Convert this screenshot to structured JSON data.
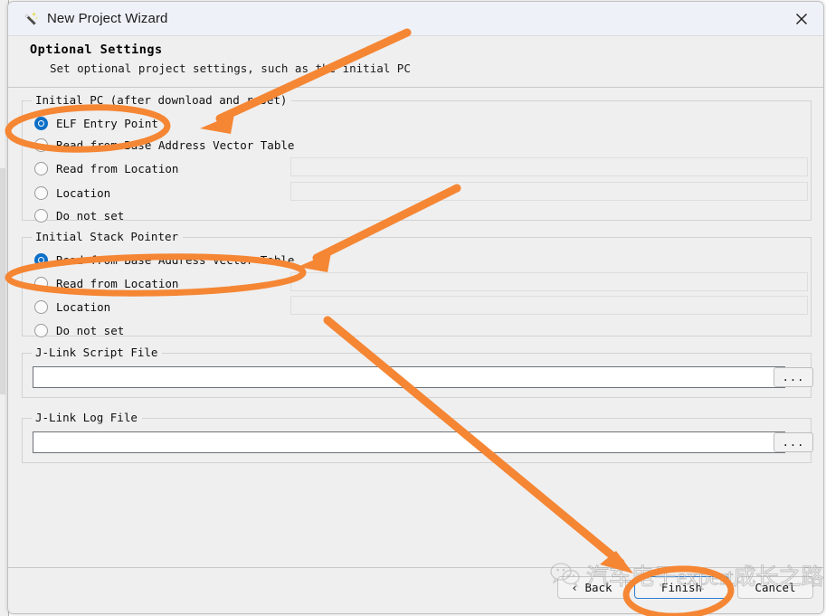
{
  "window": {
    "title": "New Project Wizard",
    "icon": "magic-wand-icon",
    "close_label": "✕"
  },
  "header": {
    "title": "Optional Settings",
    "subtitle": "Set optional project settings, such as the initial PC"
  },
  "groups": [
    {
      "id": "initial-pc",
      "legend": "Initial PC (after download and reset)",
      "options": [
        {
          "label": "ELF Entry Point",
          "checked": true,
          "field": false
        },
        {
          "label": "Read from Base Address Vector Table",
          "checked": false,
          "field": false
        },
        {
          "label": "Read from Location",
          "checked": false,
          "field": true,
          "value": ""
        },
        {
          "label": "Location",
          "checked": false,
          "field": true,
          "value": ""
        },
        {
          "label": "Do not set",
          "checked": false,
          "field": false
        }
      ]
    },
    {
      "id": "initial-stack-pointer",
      "legend": "Initial Stack Pointer",
      "options": [
        {
          "label": "Read from Base Address Vector Table",
          "checked": true,
          "field": false
        },
        {
          "label": "Read from Location",
          "checked": false,
          "field": true,
          "value": ""
        },
        {
          "label": "Location",
          "checked": false,
          "field": true,
          "value": ""
        },
        {
          "label": "Do not set",
          "checked": false,
          "field": false
        }
      ]
    }
  ],
  "file_groups": [
    {
      "id": "jlink-script-file",
      "legend": "J-Link Script File",
      "value": "",
      "browse_label": "..."
    },
    {
      "id": "jlink-log-file",
      "legend": "J-Link Log File",
      "value": "",
      "browse_label": "..."
    }
  ],
  "footer": {
    "back_label": "‹ Back",
    "finish_label": "Finish",
    "cancel_label": "Cancel"
  },
  "watermark": {
    "text": "汽车电子expert成长之路",
    "icon": "wechat-icon"
  },
  "annotations": {
    "color": "#f58634",
    "highlights": [
      {
        "target": "ELF Entry Point",
        "shape": "ellipse"
      },
      {
        "target": "Read from Base Address Vector Table",
        "shape": "ellipse"
      },
      {
        "target": "Finish",
        "shape": "ellipse"
      }
    ],
    "arrows": [
      {
        "to": "ELF Entry Point"
      },
      {
        "to": "Read from Base Address Vector Table"
      },
      {
        "to": "Finish"
      }
    ]
  }
}
